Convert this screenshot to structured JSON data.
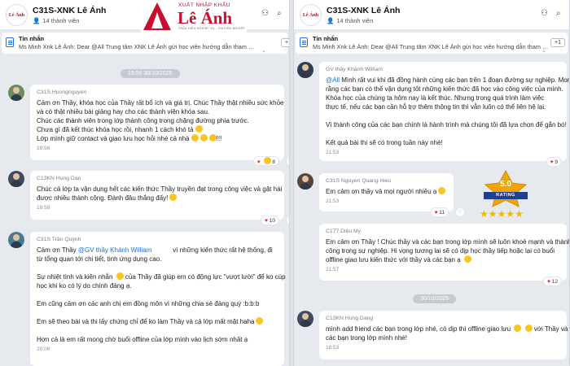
{
  "group": {
    "title": "C31S-XNK Lê Ánh",
    "members": "14 thành viên",
    "avatar_text": "Lê Ánh"
  },
  "brand": {
    "subtitle": "XUẤT NHẬP KHẨU",
    "name": "Lê Ánh",
    "tagline": "THẤU HIỂU NGHIỆP VỤ - CHUYÊN NGHIỆP"
  },
  "pinned": {
    "title": "Tin nhắn",
    "text": "Ms Minh Xnk Lê Ánh: Dear @All Trung tâm XNK Lê Ánh gửi học viên hướng dẫn tham gia Khóa h...",
    "more": "+1",
    "more_left": "+1"
  },
  "left": {
    "date": "19:56 30/10/2025",
    "messages": [
      {
        "sender": "C31S Huongnguyen",
        "lines": [
          "Cảm ơn Thầy, khóa học của Thầy rất bổ ích và giá trị. Chúc Thầy thật nhiều sức khỏe",
          "và có thật nhiều bài giảng hay cho các thành viên khóa sau.",
          "Chúc các thành viên trong lớp thành công trong chặng đường phía trước.",
          "Chưa gì đã kết thúc khóa học rồi,  nhanh 1 cách khó tả",
          "Lớp mình giữ contact và giao lưu học hỏi nhé cả nhà",
          "!!!"
        ],
        "time": "19:56",
        "reaction": "8"
      },
      {
        "sender": "C13KN Hung Dan",
        "lines": [
          "Chúc cả lớp ta vận dụng hết các kiến thức Thầy truyền đạt trong công việc và gặt hái",
          "được nhiều thành công. Đánh đâu thắng đấy!"
        ],
        "time": "19:58",
        "reaction": "10"
      },
      {
        "sender": "C31S Trần Quỳnh",
        "mention": "@GV thầy Khánh William",
        "lines": [
          "Cảm ơn Thầy",
          "vì những kiến thức rất hệ thống, đi",
          "từ tổng quan tới chi tiết, tinh ứng dụng cao.",
          "Sự nhiệt tình và kiên nhẫn",
          "của Thầy đã giúp em có động lực \"vượt lười\" để ko cúp",
          "học khi ko có lý do chính đáng ạ.",
          "Em cũng cảm ơn các anh chị em đồng môn vì những chia sẻ đáng quý :b:b:b",
          "Em sẽ theo bài và thi lấy chứng chỉ để ko làm Thầy và cả lớp mất mặt haha",
          "Hơn cả là em rất mong chờ buổi offline của lớp mình vào lịch sớm nhất ạ"
        ],
        "time": "20:06"
      }
    ]
  },
  "right": {
    "date": "30/10/2025",
    "messages": [
      {
        "sender": "GV thầy Khánh William",
        "mention": "@All",
        "lines": [
          "Mình rất vui khi đã đồng hành cùng các bạn trên 1 đoạn đường sự nghiệp. Mong",
          "rằng các bạn có thể vận dụng tốt những kiến thức đã học vào công việc của mình.",
          "Khóa học của chúng ta hôm nay là kết thúc. Nhưng trong quá trình làm việc",
          "thực tế, nếu các bạn cần hỗ trợ thêm thông tin thì vẫn luôn có thể liên hệ lại.",
          "Vì thành công của các bạn chính là hành trình mà chúng tôi đã lựa chọn để gắn bó!",
          "Kết quả bài thi sẽ có trong tuần này nhé!"
        ],
        "time": "21:53",
        "reaction": "9"
      },
      {
        "sender": "C31S Nguyen Quang Hieu",
        "lines": [
          "Em cảm ơn thầy và mọi người nhiều ạ"
        ],
        "time": "21:53",
        "reaction": "11"
      },
      {
        "sender": "C177 Diệu My",
        "lines": [
          "Em cảm ơn Thầy ! Chúc thầy và các bạn trong lớp mình sẽ luôn khoẻ mạnh và thành",
          "công trong sự nghiệp. Hi vọng tương lai sẽ có dịp học thầy tiếp hoặc lại có buổi",
          "offline giao lưu kiến thức với thầy và các bạn ạ"
        ],
        "time": "21:57",
        "reaction": "12"
      },
      {
        "sender": "C13KN Hung Dang",
        "lines": [
          "mình add friend các bạn trong lớp nhé, có dịp thì offline giao lưu",
          "với Thầy và",
          "các bạn trong lớp mình nhé!"
        ],
        "time": "18:53"
      }
    ]
  },
  "rating": {
    "value": "5.0",
    "label": "RATING",
    "stars": 5
  },
  "colors": {
    "brand_red": "#c8102e",
    "mention_blue": "#1a6fd8",
    "heart_red": "#e5242b",
    "star_gold": "#f5b400"
  },
  "icons": [
    "group-avatar",
    "user-icon",
    "search-icon",
    "add-member-icon",
    "pinned-message-icon",
    "heart-icon",
    "like-icon",
    "star-icon"
  ]
}
